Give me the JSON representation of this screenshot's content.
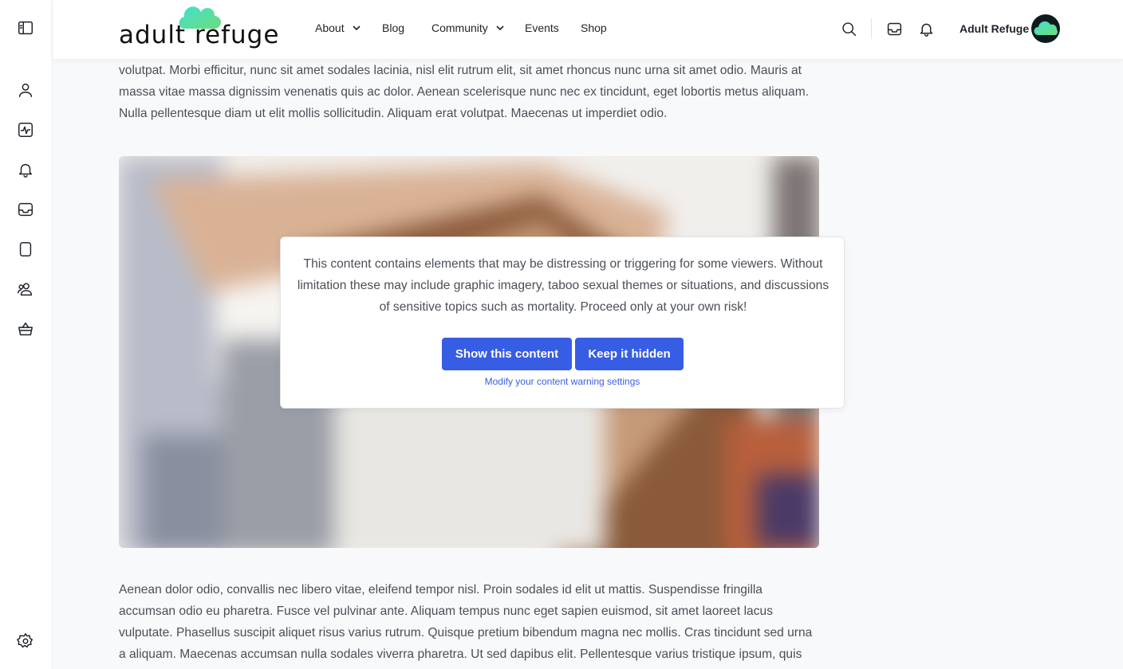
{
  "brand": {
    "logo_text": "adult refuge",
    "colors": {
      "accent": "#385de5",
      "logo_cyan": "#3ee0d0",
      "logo_green": "#6fdc7a"
    }
  },
  "sidebar": {
    "items": [
      {
        "icon": "panel-toggle-icon"
      },
      {
        "icon": "user-icon"
      },
      {
        "icon": "activity-icon"
      },
      {
        "icon": "bell-icon"
      },
      {
        "icon": "inbox-icon"
      },
      {
        "icon": "document-icon"
      },
      {
        "icon": "groups-icon"
      },
      {
        "icon": "basket-icon"
      },
      {
        "icon": "settings-icon"
      }
    ]
  },
  "header": {
    "nav": [
      {
        "label": "About",
        "dropdown": true
      },
      {
        "label": "Blog",
        "dropdown": false
      },
      {
        "label": "Community",
        "dropdown": true
      },
      {
        "label": "Events",
        "dropdown": false
      },
      {
        "label": "Shop",
        "dropdown": false
      }
    ],
    "icons": [
      "search-icon",
      "inbox-icon",
      "bell-icon"
    ],
    "user_name": "Adult Refuge"
  },
  "content": {
    "para_top": "senectus et netus et malesuada fames ac turpis egestas. Aenean dictum lorem sed nisi sodales consequat. Aliquam erat volutpat. Morbi efficitur, nunc sit amet sodales lacinia, nisl elit rutrum elit, sit amet rhoncus nunc urna sit amet odio. Mauris at massa vitae massa dignissim venenatis quis ac dolor. Aenean scelerisque nunc nec ex tincidunt, eget lobortis metus aliquam. Nulla pellentesque diam ut elit mollis sollicitudin. Aliquam erat volutpat. Maecenas ut imperdiet odio.",
    "para_bottom": "Aenean dolor odio, convallis nec libero vitae, eleifend tempor nisl. Proin sodales id elit ut mattis. Suspendisse fringilla accumsan odio eu pharetra. Fusce vel pulvinar ante. Aliquam tempus nunc eget sapien euismod, sit amet laoreet lacus vulputate. Phasellus suscipit aliquet risus varius rutrum. Quisque pretium bibendum magna nec mollis. Cras tincidunt sed urna a aliquam. Maecenas accumsan nulla sodales viverra pharetra. Ut sed dapibus elit. Pellentesque varius tristique ipsum, quis ullamcorper mauris mattis"
  },
  "warning": {
    "text": "This content contains elements that may be distressing or triggering for some viewers. Without limitation these may include graphic imagery, taboo sexual themes or situations, and discussions of sensitive topics such as mortality. Proceed only at your own risk!",
    "show_label": "Show this content",
    "hide_label": "Keep it hidden",
    "settings_link": "Modify your content warning settings"
  }
}
